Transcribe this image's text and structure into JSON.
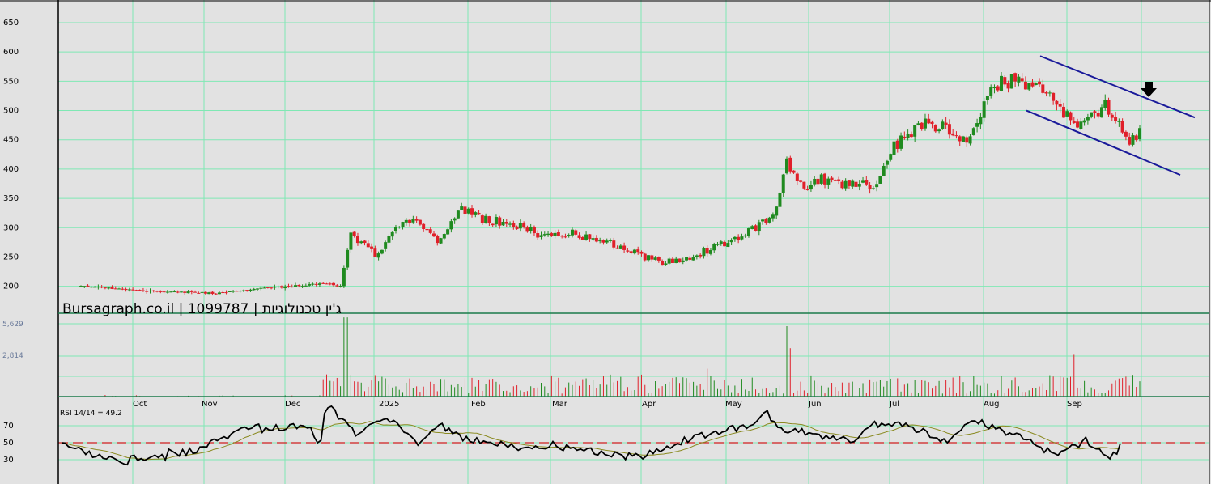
{
  "watermark": "Bursagraph.co.il | 1099787 | ג'ין טכנולוגיות",
  "colors": {
    "background": "#e2e2e2",
    "grid": "#7fe8b4",
    "up_candle": "#1f8a1f",
    "down_candle": "#e0202a",
    "channel": "#1a1a9a",
    "rsi_line": "#000000",
    "rsi_ma": "#8a8a20",
    "rsi_mid": "#d02020",
    "arrow": "#000000"
  },
  "chart_data": [
    {
      "type": "candlestick",
      "panel": "price",
      "ylim": [
        185,
        670
      ],
      "y_ticks": [
        200,
        250,
        300,
        350,
        400,
        450,
        500,
        550,
        600,
        650
      ],
      "x_ticks": [
        "Oct",
        "Nov",
        "Dec",
        "2025",
        "Feb",
        "Mar",
        "Apr",
        "May",
        "Jun",
        "Jul",
        "Aug",
        "Sep"
      ],
      "anchors": [
        {
          "i": 0,
          "v": 200
        },
        {
          "i": 20,
          "v": 192
        },
        {
          "i": 40,
          "v": 188
        },
        {
          "i": 50,
          "v": 195
        },
        {
          "i": 60,
          "v": 200
        },
        {
          "i": 70,
          "v": 205
        },
        {
          "i": 75,
          "v": 200
        },
        {
          "i": 78,
          "v": 290
        },
        {
          "i": 85,
          "v": 255
        },
        {
          "i": 92,
          "v": 300
        },
        {
          "i": 96,
          "v": 320
        },
        {
          "i": 103,
          "v": 280
        },
        {
          "i": 110,
          "v": 330
        },
        {
          "i": 116,
          "v": 315
        },
        {
          "i": 126,
          "v": 305
        },
        {
          "i": 132,
          "v": 290
        },
        {
          "i": 142,
          "v": 290
        },
        {
          "i": 154,
          "v": 270
        },
        {
          "i": 168,
          "v": 240
        },
        {
          "i": 176,
          "v": 250
        },
        {
          "i": 184,
          "v": 268
        },
        {
          "i": 192,
          "v": 290
        },
        {
          "i": 200,
          "v": 318
        },
        {
          "i": 204,
          "v": 410
        },
        {
          "i": 209,
          "v": 360
        },
        {
          "i": 214,
          "v": 385
        },
        {
          "i": 222,
          "v": 370
        },
        {
          "i": 230,
          "v": 375
        },
        {
          "i": 235,
          "v": 440
        },
        {
          "i": 243,
          "v": 480
        },
        {
          "i": 250,
          "v": 470
        },
        {
          "i": 257,
          "v": 450
        },
        {
          "i": 263,
          "v": 540
        },
        {
          "i": 270,
          "v": 555
        },
        {
          "i": 278,
          "v": 540
        },
        {
          "i": 283,
          "v": 500
        },
        {
          "i": 290,
          "v": 475
        },
        {
          "i": 296,
          "v": 510
        },
        {
          "i": 303,
          "v": 440
        },
        {
          "i": 306,
          "v": 470
        }
      ],
      "channel_upper": [
        [
          "Aug 19",
          593
        ],
        [
          "Sep 30",
          488
        ]
      ],
      "channel_lower": [
        [
          "Aug 12",
          500
        ],
        [
          "Sep 28",
          390
        ]
      ],
      "annotations": [
        "down-arrow at upper channel line, late Sep"
      ]
    },
    {
      "type": "bar",
      "panel": "volume",
      "y_ticks": [
        "5,629",
        "2,814"
      ],
      "ylim": [
        0,
        5629
      ]
    },
    {
      "type": "line",
      "panel": "rsi",
      "title": "RSI 14/14 = 49.2",
      "ylim": [
        10,
        95
      ],
      "y_ticks": [
        30,
        50,
        70
      ],
      "reference_line": 50,
      "last_value": 49.2
    }
  ]
}
